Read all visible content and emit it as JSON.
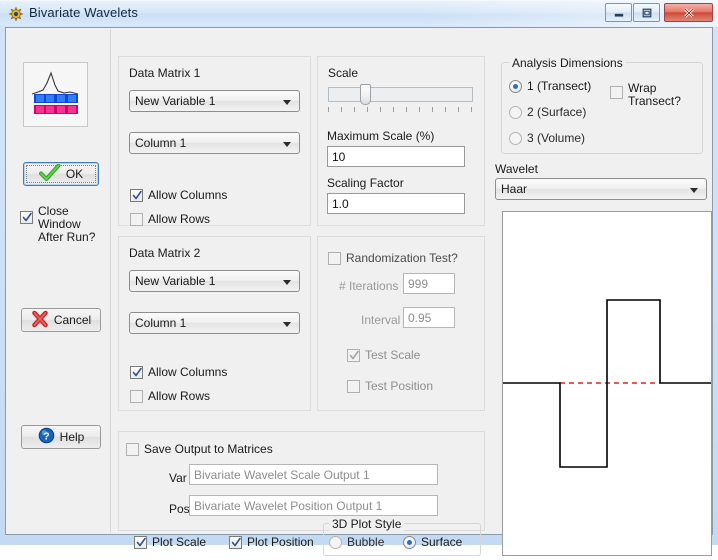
{
  "window": {
    "title": "Bivariate Wavelets",
    "icon": "app-gear-icon",
    "minimize_label": "Minimize",
    "maximize_label": "Maximize",
    "close_label": "Close"
  },
  "sidebar": {
    "preview_icon": "wavelet-preview-icon",
    "ok_label": "OK",
    "cancel_label": "Cancel",
    "help_label": "Help",
    "close_after_run": {
      "line1": "Close Window",
      "line2": "After Run?",
      "checked": true
    }
  },
  "data_matrix_1": {
    "title": "Data Matrix 1",
    "variable": "New Variable 1",
    "column": "Column 1",
    "allow_columns_label": "Allow Columns",
    "allow_columns_checked": true,
    "allow_rows_label": "Allow Rows",
    "allow_rows_checked": false
  },
  "data_matrix_2": {
    "title": "Data Matrix 2",
    "variable": "New Variable 1",
    "column": "Column 1",
    "allow_columns_label": "Allow Columns",
    "allow_columns_checked": true,
    "allow_rows_label": "Allow Rows",
    "allow_rows_checked": false
  },
  "scale": {
    "title": "Scale",
    "slider_value": 22,
    "max_scale_label": "Maximum Scale (%)",
    "max_scale_value": "10",
    "scaling_factor_label": "Scaling Factor",
    "scaling_factor_value": "1.0"
  },
  "randomization": {
    "title": "Randomization Test?",
    "enabled": false,
    "iterations_label": "# Iterations",
    "iterations_value": "999",
    "interval_label": "Interval",
    "interval_value": "0.95",
    "test_scale_label": "Test Scale",
    "test_scale_checked": true,
    "test_position_label": "Test Position",
    "test_position_checked": false
  },
  "analysis_dimensions": {
    "legend": "Analysis Dimensions",
    "options": [
      {
        "label": "1 (Transect)",
        "selected": true
      },
      {
        "label": "2 (Surface)",
        "selected": false
      },
      {
        "label": "3 (Volume)",
        "selected": false
      }
    ],
    "wrap_transect": {
      "line1": "Wrap",
      "line2": "Transect?",
      "checked": false
    }
  },
  "wavelet": {
    "label": "Wavelet",
    "selected": "Haar",
    "plot": {
      "type": "step",
      "baseline_color": "#d42626",
      "line_color": "#000000",
      "description": "Haar wavelet step function"
    }
  },
  "output": {
    "save_label": "Save Output to Matrices",
    "save_checked": false,
    "var_label": "Var",
    "var_value": "Bivariate Wavelet Scale Output 1",
    "pos_label": "Pos",
    "pos_value": "Bivariate Wavelet Position Output 1",
    "plot_scale_label": "Plot Scale",
    "plot_scale_checked": true,
    "plot_position_label": "Plot Position",
    "plot_position_checked": true,
    "plot_style": {
      "legend": "3D Plot Style",
      "options": [
        {
          "label": "Bubble",
          "selected": false
        },
        {
          "label": "Surface",
          "selected": true
        }
      ]
    }
  }
}
